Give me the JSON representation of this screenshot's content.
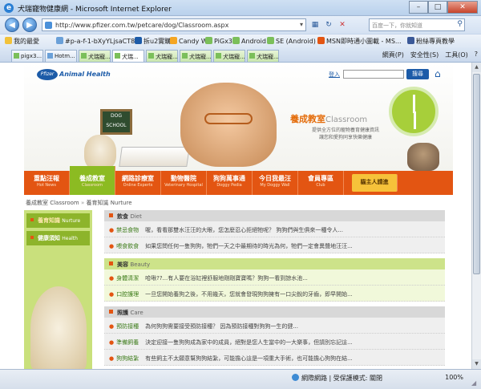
{
  "window": {
    "title": "犬瑞寵物健康網 - Microsoft Internet Explorer",
    "minimize": "–",
    "maximize": "□",
    "close": "✕"
  },
  "address": {
    "back": "◀",
    "forward": "▶",
    "url": "http://www.pfizer.com.tw/petcare/dog/Classroom.aspx",
    "search_placeholder": "百度一下，你就知道"
  },
  "favorites": {
    "label": "我的最愛",
    "items": [
      "#p-a-f-1-bXyYLjsaCT8",
      "拆u2實購",
      "Candy Wu",
      "PiGx3",
      "Android",
      "SE (Android)",
      "MSN即時通小圖載 - MS...",
      "粉絲專頁教學"
    ]
  },
  "tabs": [
    "pigx3...",
    "Hotm...",
    "犬瑞寵...",
    "犬瑞...",
    "犬瑞寵...",
    "犬瑞寵...",
    "犬瑞寵...",
    "犬瑞寵..."
  ],
  "commands": [
    "網頁(P)",
    "安全性(S)",
    "工具(O)",
    "?"
  ],
  "site": {
    "logo": "Pfizer",
    "brand": "Animal Health",
    "login": "登入",
    "search_button": "搜尋",
    "chalkboard": "DOG SCHOOL",
    "classroom_zh": "養成教室",
    "classroom_en": "Classroom",
    "tagline": "提供全方位的寵物養育健康資訊 讓您和愛狗同享快樂健康"
  },
  "nav": [
    {
      "zh": "重點汪報",
      "en": "Hot News"
    },
    {
      "zh": "養成教室",
      "en": "Classroom"
    },
    {
      "zh": "網路診療室",
      "en": "Online Experts"
    },
    {
      "zh": "動物醫院",
      "en": "Veterinary Hospital"
    },
    {
      "zh": "狗狗萬事通",
      "en": "Doggy Pedia"
    },
    {
      "zh": "今日我最汪",
      "en": "My Doggy Wall"
    },
    {
      "zh": "會員專區",
      "en": "Club"
    },
    {
      "zh": "貓主人請進",
      "en": ""
    }
  ],
  "breadcrumb": {
    "first": "養成教室 Classroom",
    "sep": "»",
    "second": "養育知識 Nurture"
  },
  "sidebar": [
    {
      "zh": "養育知識",
      "en": "Nurture"
    },
    {
      "zh": "健康須知",
      "en": "Health"
    }
  ],
  "sections": [
    {
      "zh": "飲食",
      "en": "Diet",
      "rows": [
        {
          "cat": "禁忌食物",
          "text": "喔，看看那雙水汪汪的大眼，您怎麼忍心拒絕牠呢？ 狗狗們與生俱來一種令人..."
        },
        {
          "cat": "喂食飲食",
          "text": "如果您問任何一隻狗狗，牠們一天之中最期待的時光為何，牠們一定會異聲地汪汪..."
        }
      ]
    },
    {
      "zh": "美容",
      "en": "Beauty",
      "rows": [
        {
          "cat": "身體清潔",
          "text": "哈啾??...有人要在浴缸裡舒服地剛剛寶寶嗎？狗狗一看到諒水池..."
        },
        {
          "cat": "口腔護理",
          "text": "一旦您開始養狗之後，不用幾天，您就會發現狗狗擁有一口尖銳的牙齒，即早開始..."
        }
      ]
    },
    {
      "zh": "照護",
      "en": "Care",
      "rows": [
        {
          "cat": "預防接種",
          "text": "為何狗狗需要接受預防接種？ 因為預防接種對狗狗一生的健..."
        },
        {
          "cat": "準備飼養",
          "text": "決定迎接一隻狗狗成為家中的成員，絕對是您人生當中的一大樂事，但請別忘記這..."
        },
        {
          "cat": "狗狗結紮",
          "text": "有些飼主不太願意幫狗狗結紮，可能擔心這是一項重大手術，也可能擔心狗狗在結..."
        }
      ]
    }
  ],
  "status": {
    "zone": "網際網路 | 受保護模式: 關閉",
    "zoom": "100%"
  }
}
